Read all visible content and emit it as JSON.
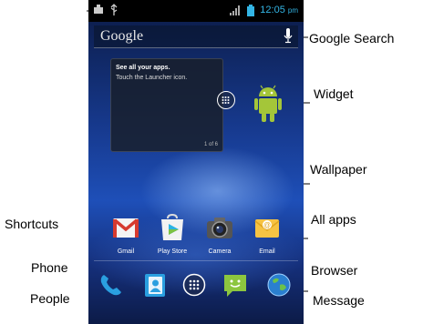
{
  "status_bar": {
    "time": "12:05",
    "ampm": "pm"
  },
  "search_bar": {
    "logo_text": "Google"
  },
  "widget": {
    "title": "See all your apps.",
    "text": "Touch the Launcher icon.",
    "page": "1 of 6"
  },
  "shortcuts": [
    {
      "label": "Gmail",
      "icon": "gmail-icon"
    },
    {
      "label": "Play Store",
      "icon": "play-store-icon"
    },
    {
      "label": "Camera",
      "icon": "camera-icon"
    },
    {
      "label": "Email",
      "icon": "email-icon"
    }
  ],
  "dock": [
    {
      "name": "phone",
      "icon": "phone-icon"
    },
    {
      "name": "people",
      "icon": "people-icon"
    },
    {
      "name": "all-apps",
      "icon": "all-apps-icon"
    },
    {
      "name": "message",
      "icon": "message-icon"
    },
    {
      "name": "browser",
      "icon": "browser-icon"
    }
  ],
  "annotations": {
    "google_search": "Google Search",
    "widget": "Widget",
    "wallpaper": "Wallpaper",
    "shortcuts": "Shortcuts",
    "all_apps": "All apps",
    "phone": "Phone",
    "browser": "Browser",
    "people": "People",
    "message": "Message"
  },
  "colors": {
    "status_accent": "#33b5e5",
    "android_green": "#a4c639"
  }
}
